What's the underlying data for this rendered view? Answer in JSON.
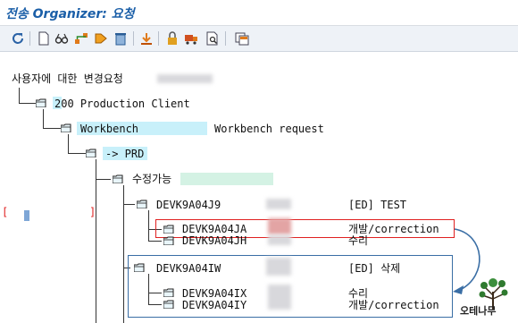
{
  "window": {
    "title": "전송 Organizer: 요청"
  },
  "toolbar": {
    "icons": [
      "refresh-icon",
      "new-document-icon",
      "glasses-icon",
      "hierarchy-icon",
      "checkout-icon",
      "delete-icon",
      "release-icon",
      "lock-icon",
      "transport-truck-icon",
      "search-doc-icon",
      "copy-icon",
      "layout-icon"
    ]
  },
  "tree": {
    "root_label": "사용자에 대한 변경요청",
    "client": "200 Production Client",
    "workbench": "Workbench",
    "workbench_desc": "Workbench request",
    "target": "-> PRD",
    "modifiable": "수정가능",
    "req1": {
      "id": "DEVK9A04J9",
      "desc": "[ED] TEST"
    },
    "req1_task1": {
      "id": "DEVK9A04JA",
      "desc": "개발/correction"
    },
    "req1_task2": {
      "id": "DEVK9A04JH",
      "desc": "수리"
    },
    "req2": {
      "id": "DEVK9A04IW",
      "desc": "[ED] 삭제"
    },
    "req2_task1": {
      "id": "DEVK9A04IX",
      "desc": "수리"
    },
    "req2_task2": {
      "id": "DEVK9A04IY",
      "desc": "개발/correction"
    }
  },
  "watermark": "오테나무",
  "colors": {
    "accent_title": "#1b5fa8",
    "highlight": "#c8f0fa",
    "red_box": "#e02020",
    "blue_box": "#3a6ea5"
  }
}
